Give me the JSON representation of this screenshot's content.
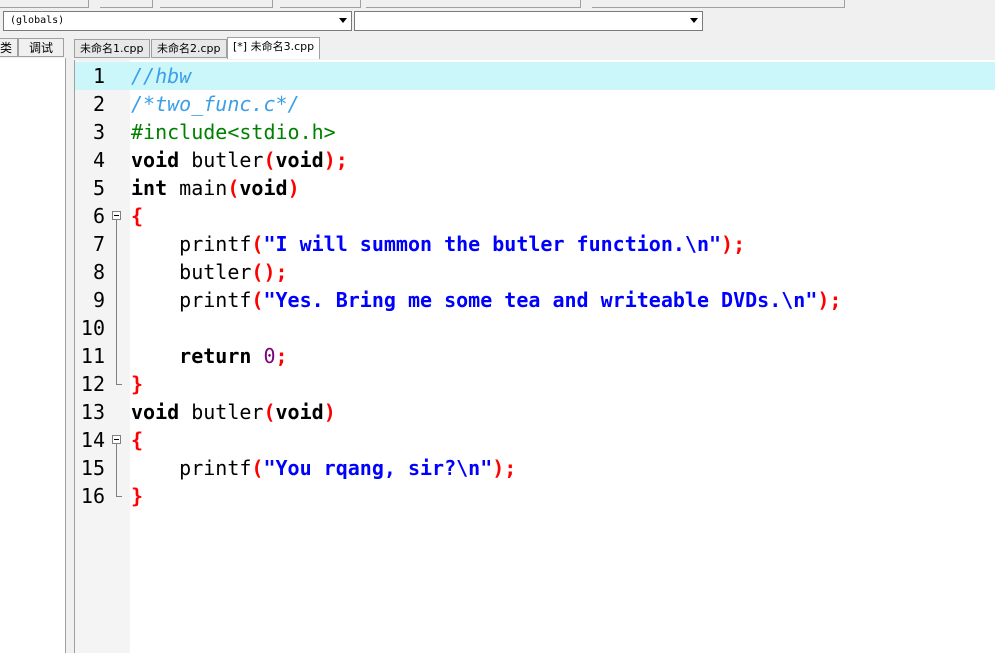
{
  "toolbar": {
    "scope_combo": "(globals)",
    "member_combo": ""
  },
  "left_tabs": [
    "类",
    "调试"
  ],
  "editor_tabs": [
    "未命名1.cpp",
    "未命名2.cpp",
    "[*] 未命名3.cpp"
  ],
  "active_tab_index": 2,
  "current_line": 1,
  "lines": [
    {
      "n": "1",
      "tokens": [
        {
          "t": "//hbw",
          "c": "cmt"
        }
      ]
    },
    {
      "n": "2",
      "tokens": [
        {
          "t": "/*two_func.c*/",
          "c": "cmt"
        }
      ]
    },
    {
      "n": "3",
      "tokens": [
        {
          "t": "#include<stdio.h>",
          "c": "pre"
        }
      ]
    },
    {
      "n": "4",
      "tokens": [
        {
          "t": "void",
          "c": "kw"
        },
        {
          "t": " butler",
          "c": "plain"
        },
        {
          "t": "(",
          "c": "sym"
        },
        {
          "t": "void",
          "c": "kw"
        },
        {
          "t": ");",
          "c": "sym"
        }
      ]
    },
    {
      "n": "5",
      "tokens": [
        {
          "t": "int",
          "c": "kw"
        },
        {
          "t": " main",
          "c": "plain"
        },
        {
          "t": "(",
          "c": "sym"
        },
        {
          "t": "void",
          "c": "kw"
        },
        {
          "t": ")",
          "c": "sym"
        }
      ]
    },
    {
      "n": "6",
      "fold": "start",
      "tokens": [
        {
          "t": "{",
          "c": "sym"
        }
      ]
    },
    {
      "n": "7",
      "tokens": [
        {
          "t": "    printf",
          "c": "plain"
        },
        {
          "t": "(",
          "c": "sym"
        },
        {
          "t": "\"I will summon the butler function.\\n\"",
          "c": "str"
        },
        {
          "t": ");",
          "c": "sym"
        }
      ]
    },
    {
      "n": "8",
      "tokens": [
        {
          "t": "    butler",
          "c": "plain"
        },
        {
          "t": "();",
          "c": "sym"
        }
      ]
    },
    {
      "n": "9",
      "tokens": [
        {
          "t": "    printf",
          "c": "plain"
        },
        {
          "t": "(",
          "c": "sym"
        },
        {
          "t": "\"Yes. Bring me some tea and writeable DVDs.\\n\"",
          "c": "str"
        },
        {
          "t": ");",
          "c": "sym"
        }
      ]
    },
    {
      "n": "10",
      "tokens": []
    },
    {
      "n": "11",
      "tokens": [
        {
          "t": "    return",
          "c": "kw"
        },
        {
          "t": " ",
          "c": "plain"
        },
        {
          "t": "0",
          "c": "num"
        },
        {
          "t": ";",
          "c": "sym"
        }
      ]
    },
    {
      "n": "12",
      "fold": "end",
      "tokens": [
        {
          "t": "}",
          "c": "sym"
        }
      ]
    },
    {
      "n": "13",
      "tokens": [
        {
          "t": "void",
          "c": "kw"
        },
        {
          "t": " butler",
          "c": "plain"
        },
        {
          "t": "(",
          "c": "sym"
        },
        {
          "t": "void",
          "c": "kw"
        },
        {
          "t": ")",
          "c": "sym"
        }
      ]
    },
    {
      "n": "14",
      "fold": "start",
      "tokens": [
        {
          "t": "{",
          "c": "sym"
        }
      ]
    },
    {
      "n": "15",
      "tokens": [
        {
          "t": "    printf",
          "c": "plain"
        },
        {
          "t": "(",
          "c": "sym"
        },
        {
          "t": "\"You rqang, sir?\\n\"",
          "c": "str"
        },
        {
          "t": ");",
          "c": "sym"
        }
      ]
    },
    {
      "n": "16",
      "fold": "end",
      "tokens": [
        {
          "t": "}",
          "c": "sym"
        }
      ]
    }
  ]
}
